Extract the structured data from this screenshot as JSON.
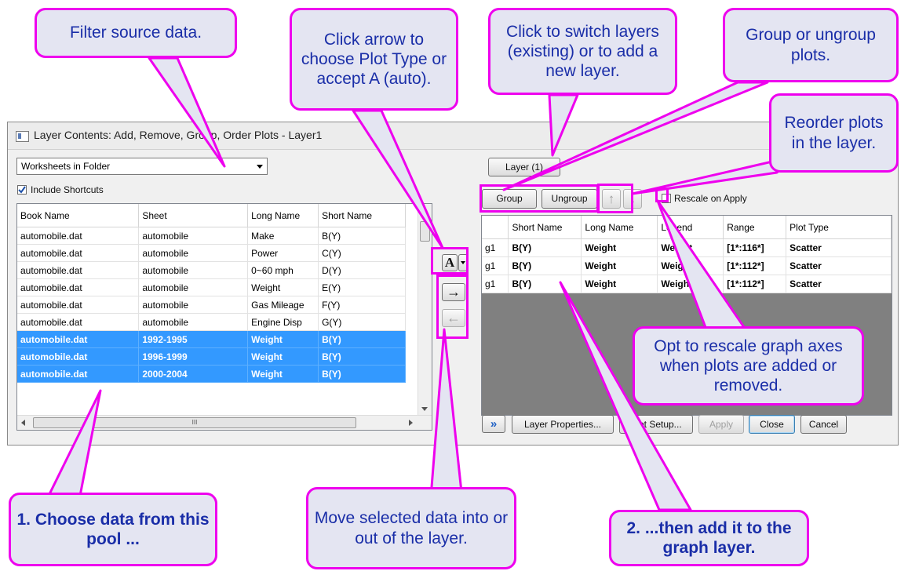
{
  "dialog": {
    "title": "Layer Contents: Add, Remove, Group, Order Plots - Layer1",
    "source_filter": "Worksheets in Folder",
    "include_shortcuts_label": "Include Shortcuts",
    "include_shortcuts_checked": true,
    "left_table": {
      "headers": [
        "Book Name",
        "Sheet",
        "Long Name",
        "Short Name"
      ],
      "rows": [
        {
          "book": "automobile.dat",
          "sheet": "automobile",
          "long": "Make",
          "short": "B(Y)",
          "selected": false
        },
        {
          "book": "automobile.dat",
          "sheet": "automobile",
          "long": "Power",
          "short": "C(Y)",
          "selected": false
        },
        {
          "book": "automobile.dat",
          "sheet": "automobile",
          "long": "0~60 mph",
          "short": "D(Y)",
          "selected": false
        },
        {
          "book": "automobile.dat",
          "sheet": "automobile",
          "long": "Weight",
          "short": "E(Y)",
          "selected": false
        },
        {
          "book": "automobile.dat",
          "sheet": "automobile",
          "long": "Gas Mileage",
          "short": "F(Y)",
          "selected": false
        },
        {
          "book": "automobile.dat",
          "sheet": "automobile",
          "long": "Engine Disp",
          "short": "G(Y)",
          "selected": false
        },
        {
          "book": "automobile.dat",
          "sheet": "1992-1995",
          "long": "Weight",
          "short": "B(Y)",
          "selected": true
        },
        {
          "book": "automobile.dat",
          "sheet": "1996-1999",
          "long": "Weight",
          "short": "B(Y)",
          "selected": true
        },
        {
          "book": "automobile.dat",
          "sheet": "2000-2004",
          "long": "Weight",
          "short": "B(Y)",
          "selected": true
        }
      ],
      "hscroll_glyph": "III"
    },
    "plot_type_button": "A",
    "add_arrow": "→",
    "remove_arrow": "←",
    "layer_button": "Layer (1)",
    "group_button": "Group",
    "ungroup_button": "Ungroup",
    "move_up_arrow": "↑",
    "move_down_arrow": "↓",
    "rescale_label": "Rescale on Apply",
    "rescale_checked": false,
    "right_table": {
      "headers": [
        "",
        "Short Name",
        "Long Name",
        "Legend",
        "Range",
        "Plot Type"
      ],
      "rows": [
        {
          "group": "g1",
          "short": "B(Y)",
          "long": "Weight",
          "legend": "Weight",
          "range": "[1*:116*]",
          "plot_type": "Scatter"
        },
        {
          "group": "g1",
          "short": "B(Y)",
          "long": "Weight",
          "legend": "Weight",
          "range": "[1*:112*]",
          "plot_type": "Scatter"
        },
        {
          "group": "g1",
          "short": "B(Y)",
          "long": "Weight",
          "legend": "Weight",
          "range": "[1*:112*]",
          "plot_type": "Scatter"
        }
      ]
    },
    "expand_button": "»",
    "layer_properties_button": "Layer Properties...",
    "plot_setup_button": "Plot Setup...",
    "apply_button": "Apply",
    "close_button": "Close",
    "cancel_button": "Cancel"
  },
  "callouts": {
    "filter": "Filter source data.",
    "plot_type": "Click arrow to choose Plot Type or accept A (auto).",
    "layers": "Click to switch layers (existing) or to add a new layer.",
    "group": "Group or ungroup plots.",
    "reorder": "Reorder plots in the layer.",
    "rescale": "Opt to rescale graph axes when plots are added or removed.",
    "choose": "1. Choose data from this pool ...",
    "move": "Move selected data into or out of the layer.",
    "add": "2. ...then add it to the graph layer."
  },
  "colors": {
    "annotation_border": "#ee00ee",
    "annotation_fill": "#e4e5f2",
    "annotation_text": "#1a2ea8",
    "selection": "#3399ff"
  }
}
